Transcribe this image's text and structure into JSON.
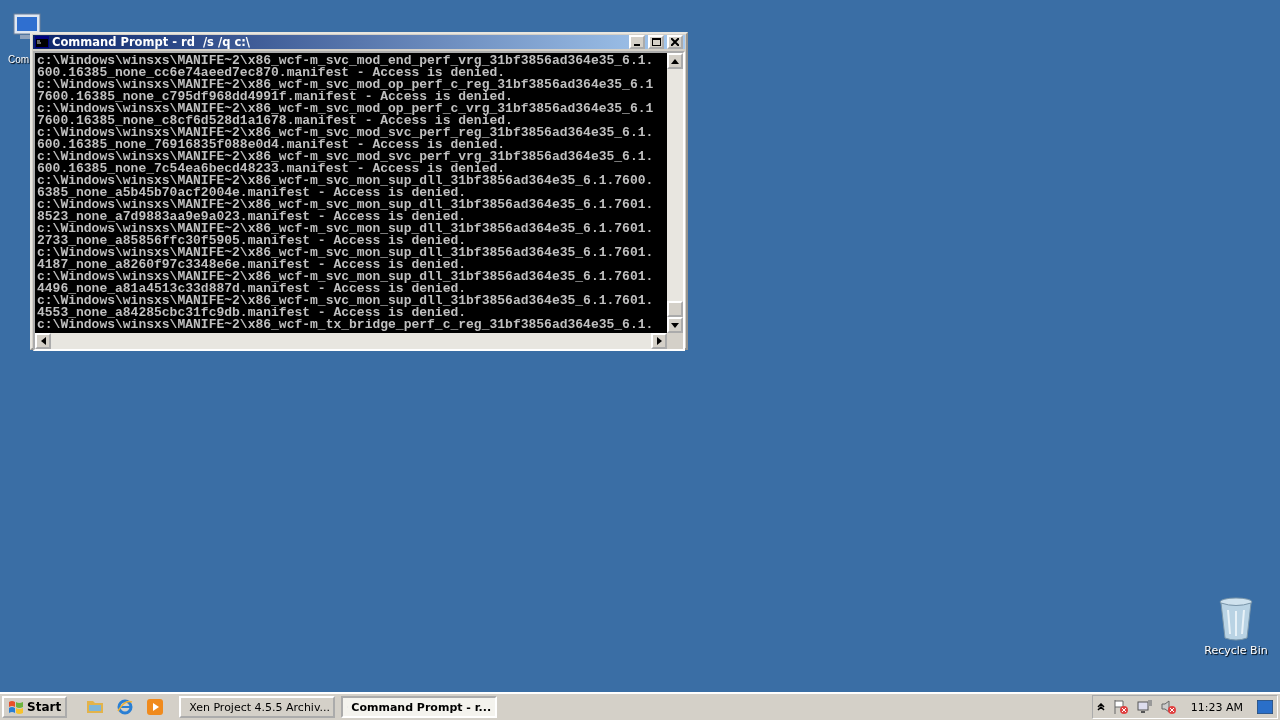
{
  "desktop_icons": [
    {
      "kind": "computer",
      "label": "Com"
    },
    {
      "kind": "recycle_bin",
      "label": "Recycle Bin"
    }
  ],
  "window": {
    "title": "Command Prompt - rd  /s /q c:\\",
    "lines": [
      "c:\\Windows\\winsxs\\MANIFE~2\\x86_wcf-m_svc_mod_end_perf_vrg_31bf3856ad364e35_6.1.",
      "600.16385_none_cc6e74aeed7ec870.manifest - Access is denied.",
      "c:\\Windows\\winsxs\\MANIFE~2\\x86_wcf-m_svc_mod_op_perf_c_reg_31bf3856ad364e35_6.1",
      "7600.16385_none_c795df968dd4991f.manifest - Access is denied.",
      "c:\\Windows\\winsxs\\MANIFE~2\\x86_wcf-m_svc_mod_op_perf_c_vrg_31bf3856ad364e35_6.1",
      "7600.16385_none_c8cf6d528d1a1678.manifest - Access is denied.",
      "c:\\Windows\\winsxs\\MANIFE~2\\x86_wcf-m_svc_mod_svc_perf_reg_31bf3856ad364e35_6.1.",
      "600.16385_none_76916835f088e0d4.manifest - Access is denied.",
      "c:\\Windows\\winsxs\\MANIFE~2\\x86_wcf-m_svc_mod_svc_perf_vrg_31bf3856ad364e35_6.1.",
      "600.16385_none_7c54ea6becd48233.manifest - Access is denied.",
      "c:\\Windows\\winsxs\\MANIFE~2\\x86_wcf-m_svc_mon_sup_dll_31bf3856ad364e35_6.1.7600.",
      "6385_none_a5b45b70acf2004e.manifest - Access is denied.",
      "c:\\Windows\\winsxs\\MANIFE~2\\x86_wcf-m_svc_mon_sup_dll_31bf3856ad364e35_6.1.7601.",
      "8523_none_a7d9883aa9e9a023.manifest - Access is denied.",
      "c:\\Windows\\winsxs\\MANIFE~2\\x86_wcf-m_svc_mon_sup_dll_31bf3856ad364e35_6.1.7601.",
      "2733_none_a85856ffc30f5905.manifest - Access is denied.",
      "c:\\Windows\\winsxs\\MANIFE~2\\x86_wcf-m_svc_mon_sup_dll_31bf3856ad364e35_6.1.7601.",
      "4187_none_a8260f97c3348e6e.manifest - Access is denied.",
      "c:\\Windows\\winsxs\\MANIFE~2\\x86_wcf-m_svc_mon_sup_dll_31bf3856ad364e35_6.1.7601.",
      "4496_none_a81a4513c33d887d.manifest - Access is denied.",
      "c:\\Windows\\winsxs\\MANIFE~2\\x86_wcf-m_svc_mon_sup_dll_31bf3856ad364e35_6.1.7601.",
      "4553_none_a84285cbc31fc9db.manifest - Access is denied.",
      "c:\\Windows\\winsxs\\MANIFE~2\\x86_wcf-m_tx_bridge_perf_c_reg_31bf3856ad364e35_6.1."
    ]
  },
  "taskbar": {
    "start": "Start",
    "tasks": [
      {
        "kind": "browser",
        "label": "Xen Project 4.5.5 Archiv...",
        "selected": false
      },
      {
        "kind": "console",
        "label": "Command Prompt - r...",
        "selected": true
      }
    ],
    "clock": "11:23 AM"
  }
}
